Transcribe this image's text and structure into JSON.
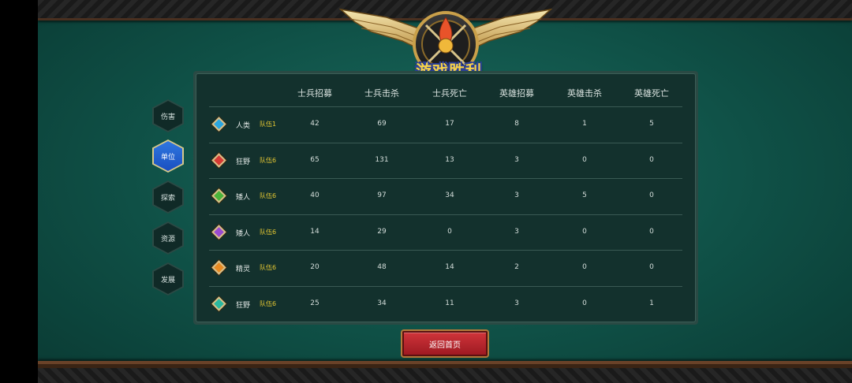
{
  "title": "游戏胜利",
  "tabs": [
    {
      "label": "伤害",
      "active": false
    },
    {
      "label": "单位",
      "active": true
    },
    {
      "label": "探索",
      "active": false
    },
    {
      "label": "资源",
      "active": false
    },
    {
      "label": "发展",
      "active": false
    }
  ],
  "columns": [
    "士兵招募",
    "士兵击杀",
    "士兵死亡",
    "英雄招募",
    "英雄击杀",
    "英雄死亡"
  ],
  "rows": [
    {
      "race": "人类",
      "team": "队伍1",
      "gem_color": "#2aa6e0",
      "values": [
        "42",
        "69",
        "17",
        "8",
        "1",
        "5"
      ]
    },
    {
      "race": "狂野",
      "team": "队伍6",
      "gem_color": "#d63a34",
      "values": [
        "65",
        "131",
        "13",
        "3",
        "0",
        "0"
      ]
    },
    {
      "race": "矮人",
      "team": "队伍6",
      "gem_color": "#4ab43a",
      "values": [
        "40",
        "97",
        "34",
        "3",
        "5",
        "0"
      ]
    },
    {
      "race": "矮人",
      "team": "队伍6",
      "gem_color": "#9a4ad0",
      "values": [
        "14",
        "29",
        "0",
        "3",
        "0",
        "0"
      ]
    },
    {
      "race": "精灵",
      "team": "队伍6",
      "gem_color": "#e88a22",
      "values": [
        "20",
        "48",
        "14",
        "2",
        "0",
        "0"
      ]
    },
    {
      "race": "狂野",
      "team": "队伍6",
      "gem_color": "#2ab8a0",
      "values": [
        "25",
        "34",
        "11",
        "3",
        "0",
        "1"
      ]
    }
  ],
  "return_button": "返回首页"
}
